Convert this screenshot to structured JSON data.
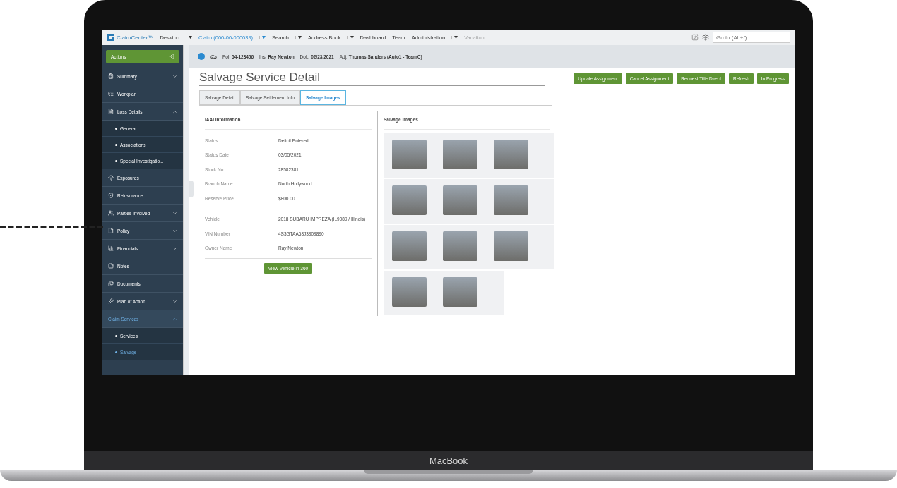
{
  "device": {
    "label": "MacBook"
  },
  "nav": {
    "product": "ClaimCenter™",
    "menus": [
      {
        "label": "Desktop",
        "dropdown": true,
        "selected": false,
        "disabled": false
      },
      {
        "label": "Claim (000-00-000039)",
        "dropdown": true,
        "selected": true,
        "disabled": false
      },
      {
        "label": "Search",
        "dropdown": true,
        "selected": false,
        "disabled": false
      },
      {
        "label": "Address Book",
        "dropdown": true,
        "selected": false,
        "disabled": false
      },
      {
        "label": "Dashboard",
        "dropdown": false,
        "selected": false,
        "disabled": false
      },
      {
        "label": "Team",
        "dropdown": false,
        "selected": false,
        "disabled": false
      },
      {
        "label": "Administration",
        "dropdown": true,
        "selected": false,
        "disabled": false
      },
      {
        "label": "Vacation",
        "dropdown": false,
        "selected": false,
        "disabled": true
      }
    ],
    "search": {
      "placeholder": "Go to (Alt+/)"
    }
  },
  "claim_bar": [
    {
      "label": "Pol:",
      "value": "54-123456"
    },
    {
      "label": "Ins:",
      "value": "Ray Newton"
    },
    {
      "label": "DoL:",
      "value": "02/23/2021"
    },
    {
      "label": "Adj:",
      "value": "Thomas Sanders (Auto1 - TeamC)"
    }
  ],
  "sidebar": {
    "actions": "Actions",
    "items": [
      {
        "label": "Summary",
        "kind": "group",
        "expanded": false,
        "selected": false
      },
      {
        "label": "Workplan",
        "kind": "link",
        "selected": false
      },
      {
        "label": "Loss Details",
        "kind": "group",
        "expanded": true,
        "selected": false,
        "children": [
          {
            "label": "General",
            "selected": false
          },
          {
            "label": "Associations",
            "selected": false
          },
          {
            "label": "Special Investigatio...",
            "selected": false
          }
        ]
      },
      {
        "label": "Exposures",
        "kind": "link",
        "selected": false
      },
      {
        "label": "Reinsurance",
        "kind": "link",
        "selected": false
      },
      {
        "label": "Parties Involved",
        "kind": "group",
        "expanded": false,
        "selected": false
      },
      {
        "label": "Policy",
        "kind": "group",
        "expanded": false,
        "selected": false
      },
      {
        "label": "Financials",
        "kind": "group",
        "expanded": false,
        "selected": false
      },
      {
        "label": "Notes",
        "kind": "link",
        "selected": false
      },
      {
        "label": "Documents",
        "kind": "link",
        "selected": false
      },
      {
        "label": "Plan of Action",
        "kind": "group",
        "expanded": false,
        "selected": false
      },
      {
        "label": "Claim Services",
        "kind": "group",
        "expanded": true,
        "selected": true,
        "children": [
          {
            "label": "Services",
            "selected": false
          },
          {
            "label": "Salvage",
            "selected": true
          }
        ]
      }
    ]
  },
  "page": {
    "title": "Salvage Service Detail",
    "buttons": [
      "Update Assignment",
      "Cancel Assignment",
      "Request Title Direct",
      "Refresh",
      "In Progress"
    ],
    "tabs": [
      {
        "label": "Salvage Detail",
        "selected": false
      },
      {
        "label": "Salvage Settlement Info",
        "selected": false
      },
      {
        "label": "Salvage Images",
        "selected": true
      }
    ],
    "info": {
      "title": "IAAI Information",
      "groups": [
        [
          {
            "label": "Status",
            "value": "Deficit Entered"
          },
          {
            "label": "Status Date",
            "value": "03/05/2021"
          },
          {
            "label": "Stock No",
            "value": "28582381"
          },
          {
            "label": "Branch Name",
            "value": "North Hollywood"
          },
          {
            "label": "Reserve Price",
            "value": "$800.00"
          }
        ],
        [
          {
            "label": "Vehicle",
            "value": "2018 SUBARU IMPREZA (IL9089 / Illinois)"
          },
          {
            "label": "VIN Number",
            "value": "4S3GTAA68J3909890"
          },
          {
            "label": "Owner Name",
            "value": "Ray Newton"
          }
        ]
      ],
      "button": "View Vehicle in 360"
    },
    "images": {
      "title": "Salvage Images"
    }
  }
}
